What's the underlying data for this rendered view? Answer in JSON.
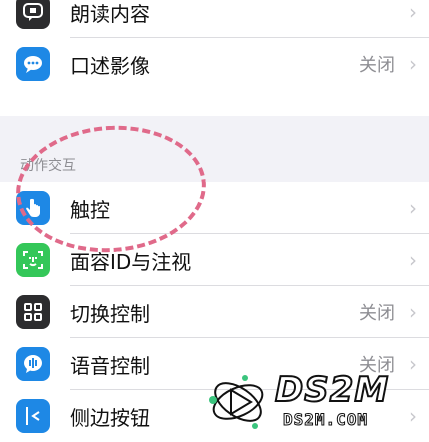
{
  "group1": {
    "items": [
      {
        "label": "朗读内容",
        "icon": "speech-bubble-icon",
        "color": "#2c2c2e"
      },
      {
        "label": "口述影像",
        "value": "关闭",
        "icon": "chat-bubble-icon",
        "color": "#1e88e5"
      }
    ]
  },
  "section": {
    "header": "动作交互"
  },
  "group2": {
    "items": [
      {
        "label": "触控",
        "icon": "hand-touch-icon",
        "color": "#1e88e5"
      },
      {
        "label": "面容ID与注视",
        "icon": "face-id-icon",
        "color": "#34c759"
      },
      {
        "label": "切换控制",
        "value": "关闭",
        "icon": "grid-icon",
        "color": "#2c2c2e"
      },
      {
        "label": "语音控制",
        "value": "关闭",
        "icon": "voice-control-icon",
        "color": "#1e88e5"
      },
      {
        "label": "侧边按钮",
        "icon": "side-button-icon",
        "color": "#1e88e5"
      }
    ]
  },
  "watermark": {
    "title": "DS2M",
    "subtitle": "DS2M.COM"
  },
  "colors": {
    "annotation": "#e06a8a",
    "chevron": "#c7c7cc",
    "secondary": "#8e8e93"
  }
}
